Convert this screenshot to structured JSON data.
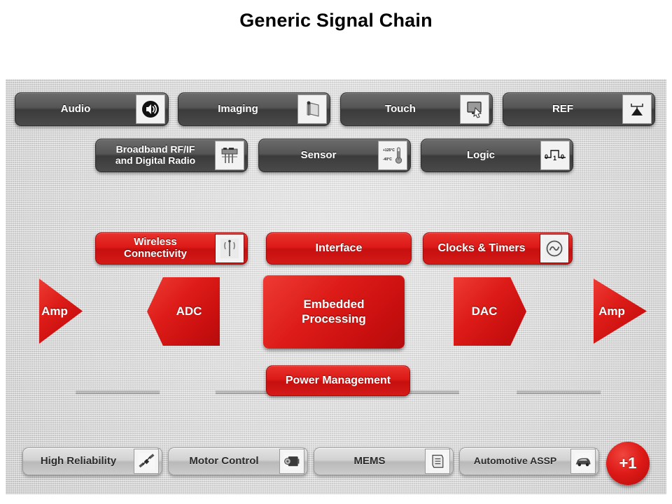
{
  "title": "Generic Signal Chain",
  "rows": {
    "top": [
      {
        "label": "Audio",
        "icon": "speaker-icon"
      },
      {
        "label": "Imaging",
        "icon": "camera-icon"
      },
      {
        "label": "Touch",
        "icon": "touchscreen-icon"
      },
      {
        "label": "REF",
        "icon": "voltage-reference-icon"
      }
    ],
    "second": [
      {
        "label": "Broadband RF/IF\nand Digital Radio",
        "icon": "rf-board-icon"
      },
      {
        "label": "Sensor",
        "icon": "thermometer-icon",
        "icon_text_hot": "+125°C",
        "icon_text_cold": "-40°C"
      },
      {
        "label": "Logic",
        "icon": "logic-waveform-icon",
        "icon_text": "0 1 0"
      }
    ],
    "red": [
      {
        "label": "Wireless\nConnectivity",
        "icon": "antenna-icon"
      },
      {
        "label": "Interface",
        "icon": null
      },
      {
        "label": "Clocks & Timers",
        "icon": "sine-wave-circle-icon"
      }
    ],
    "bottom": [
      {
        "label": "High Reliability",
        "icon": "satellite-icon"
      },
      {
        "label": "Motor Control",
        "icon": "motor-icon"
      },
      {
        "label": "MEMS",
        "icon": "document-icon"
      },
      {
        "label": "Automotive ASSP",
        "icon": "car-icon"
      }
    ]
  },
  "chain": [
    {
      "label": "Amp",
      "shape": "triangle-right"
    },
    {
      "label": "ADC",
      "shape": "pentagon-left"
    },
    {
      "label": "Embedded\nProcessing",
      "shape": "rectangle"
    },
    {
      "label": "DAC",
      "shape": "pentagon-right"
    },
    {
      "label": "Amp",
      "shape": "triangle-right"
    }
  ],
  "power_management": {
    "label": "Power Management"
  },
  "badge": {
    "label": "+1"
  },
  "colors": {
    "brand_red": "#d41b18",
    "panel_gray": "#cfcfcf",
    "dark_pill": "#4a4a4a",
    "light_pill": "#cccccc",
    "title_text": "#000000"
  }
}
